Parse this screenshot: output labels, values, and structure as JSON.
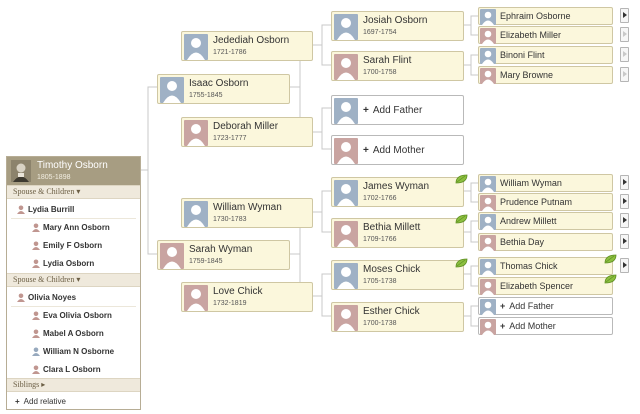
{
  "focus": {
    "name": "Timothy Osborn",
    "dates": "1805-1898"
  },
  "panel": {
    "families": [
      {
        "header": "Spouse & Children ▾",
        "spouse": "Lydia Burrill",
        "children": [
          {
            "name": "Mary Ann Osborn",
            "gender": "female"
          },
          {
            "name": "Emily F Osborn",
            "gender": "female"
          },
          {
            "name": "Lydia Osborn",
            "gender": "female"
          }
        ]
      },
      {
        "header": "Spouse & Children ▾",
        "spouse": "Olivia Noyes",
        "children": [
          {
            "name": "Eva Olivia Osborn",
            "gender": "female"
          },
          {
            "name": "Mabel A Osborn",
            "gender": "female"
          },
          {
            "name": "William N Osborne",
            "gender": "male"
          },
          {
            "name": "Clara L Osborn",
            "gender": "female"
          }
        ]
      }
    ],
    "siblings": "Siblings ▸",
    "add_relative": "Add relative"
  },
  "tree": {
    "gen1": {
      "father": {
        "name": "Isaac Osborn",
        "dates": "1755-1845"
      },
      "mother": {
        "name": "Sarah Wyman",
        "dates": "1759-1845"
      }
    },
    "gen2": [
      {
        "name": "Jedediah Osborn",
        "dates": "1721-1786"
      },
      {
        "name": "Deborah Miller",
        "dates": "1723-1777"
      },
      {
        "name": "William Wyman",
        "dates": "1730-1783"
      },
      {
        "name": "Love Chick",
        "dates": "1732-1819"
      }
    ],
    "gen3": [
      {
        "name": "Josiah Osborn",
        "dates": "1697-1754"
      },
      {
        "name": "Sarah Flint",
        "dates": "1700-1758"
      },
      {
        "add": "Add Father"
      },
      {
        "add": "Add Mother"
      },
      {
        "name": "James Wyman",
        "dates": "1702-1766"
      },
      {
        "name": "Bethia Millett",
        "dates": "1709-1766"
      },
      {
        "name": "Moses Chick",
        "dates": "1705-1738"
      },
      {
        "name": "Esther Chick",
        "dates": "1700-1738"
      }
    ],
    "gen4": [
      {
        "name": "Ephraim Osborne"
      },
      {
        "name": "Elizabeth Miller"
      },
      {
        "name": "Binoni Flint"
      },
      {
        "name": "Mary Browne"
      },
      {
        "name": "William Wyman"
      },
      {
        "name": "Prudence Putnam"
      },
      {
        "name": "Andrew Millett"
      },
      {
        "name": "Bethia Day"
      },
      {
        "name": "Thomas Chick"
      },
      {
        "name": "Elizabeth Spencer"
      },
      {
        "add": "Add Father"
      },
      {
        "add": "Add Mother"
      }
    ]
  }
}
